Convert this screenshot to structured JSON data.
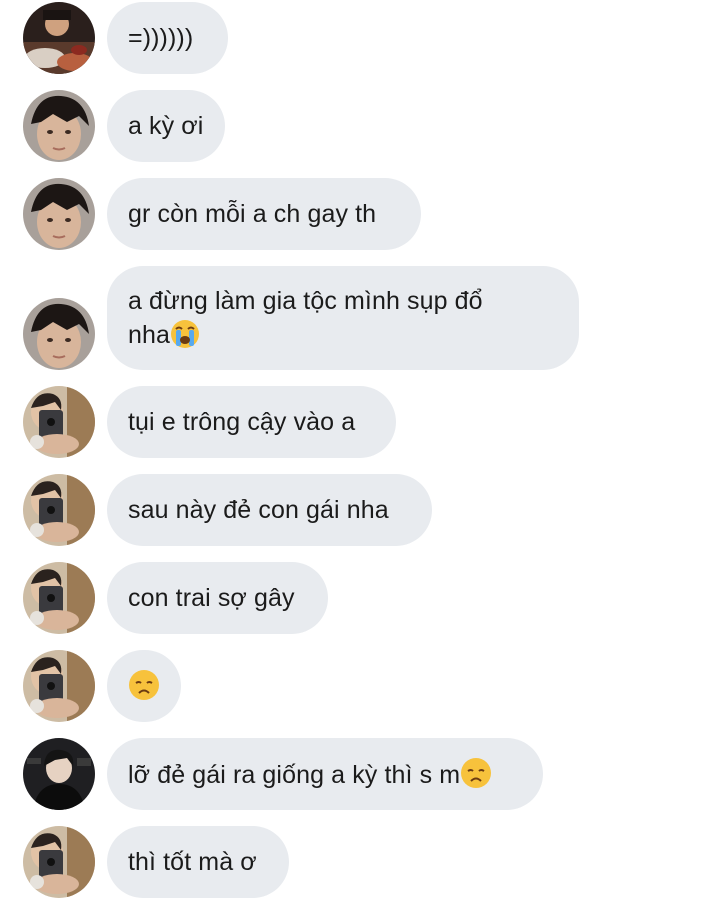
{
  "messages": [
    {
      "sender": "user-a",
      "text": "=))))))",
      "emoji": ""
    },
    {
      "sender": "user-b",
      "text": "a kỳ ơi",
      "emoji": ""
    },
    {
      "sender": "user-b",
      "text": "gr còn mỗi a ch gay th",
      "emoji": ""
    },
    {
      "sender": "user-b",
      "text": "a đừng làm gia tộc mình sụp đổ\nnha",
      "emoji": "loudly-crying-face"
    },
    {
      "sender": "user-c",
      "text": "tụi e trông cậy vào a",
      "emoji": ""
    },
    {
      "sender": "user-c",
      "text": "sau này đẻ con gái nha",
      "emoji": ""
    },
    {
      "sender": "user-c",
      "text": "con trai sợ gây",
      "emoji": ""
    },
    {
      "sender": "user-c",
      "text": "",
      "emoji": "disappointed-face"
    },
    {
      "sender": "user-d",
      "text": "lỡ đẻ gái ra giống a kỳ thì s m",
      "emoji": "disappointed-face"
    },
    {
      "sender": "user-c",
      "text": "thì tốt mà ơ",
      "emoji": ""
    }
  ],
  "colors": {
    "bubble": "#e8ebef",
    "text": "#1b1b1b",
    "background": "#ffffff"
  }
}
